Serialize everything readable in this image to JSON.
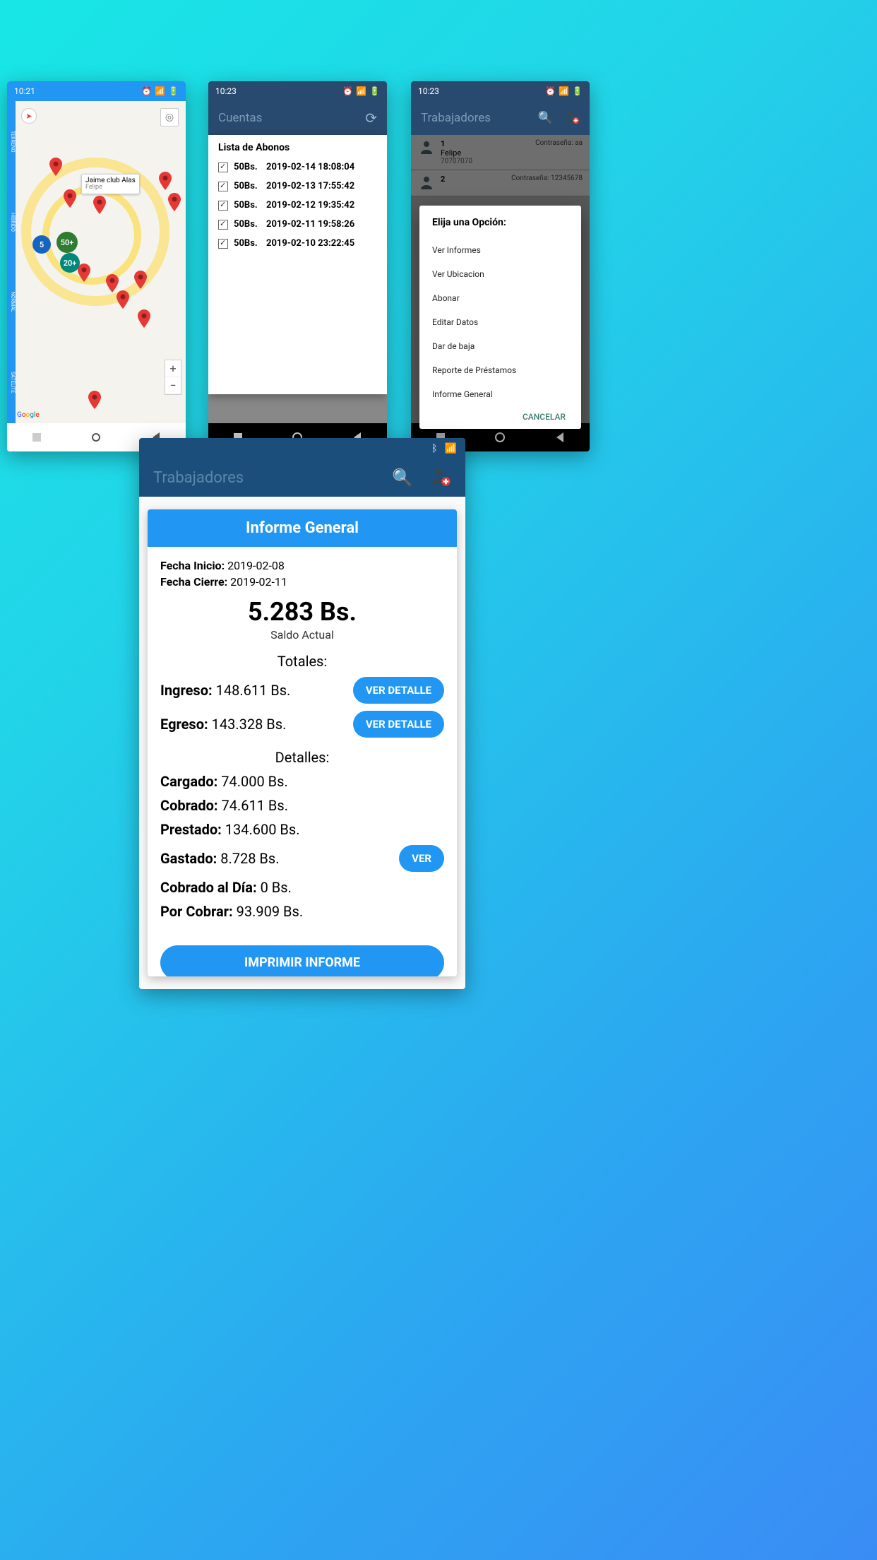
{
  "phone1": {
    "time": "10:21",
    "map": {
      "bubble_title": "Jaime club Alas",
      "bubble_sub": "Felipe",
      "clusters": {
        "green": "50+",
        "blue": "5",
        "teal": "20+"
      },
      "legend": [
        "TERRENO",
        "HÍBRIDO",
        "NORMAL",
        "SATÉLITE"
      ],
      "logo": "Google"
    }
  },
  "phone2": {
    "time": "10:23",
    "appbar": "Cuentas",
    "sheet_title": "Lista de Abonos",
    "abonos": [
      {
        "amount": "50Bs.",
        "ts": "2019-02-14 18:08:04"
      },
      {
        "amount": "50Bs.",
        "ts": "2019-02-13 17:55:42"
      },
      {
        "amount": "50Bs.",
        "ts": "2019-02-12 19:35:42"
      },
      {
        "amount": "50Bs.",
        "ts": "2019-02-11 19:58:26"
      },
      {
        "amount": "50Bs.",
        "ts": "2019-02-10 23:22:45"
      }
    ]
  },
  "phone3": {
    "time": "10:23",
    "appbar": "Trabajadores",
    "workers": [
      {
        "n": "1",
        "name": "Felipe",
        "phone": "70707070",
        "pass_label": "Contraseña:",
        "pass": "aa"
      },
      {
        "n": "2",
        "name": "",
        "phone": "",
        "pass_label": "Contraseña:",
        "pass": "12345678"
      }
    ],
    "dialog": {
      "title": "Elija una Opción:",
      "options": [
        "Ver Informes",
        "Ver Ubicacion",
        "Abonar",
        "Editar Datos",
        "Dar de baja",
        "Reporte de Préstamos",
        "Informe General"
      ],
      "cancel": "CANCELAR"
    }
  },
  "phone4": {
    "appbar": "Trabajadores",
    "card_title": "Informe General",
    "fecha_inicio_label": "Fecha Inicio:",
    "fecha_inicio": "2019-02-08",
    "fecha_cierre_label": "Fecha Cierre:",
    "fecha_cierre": "2019-02-11",
    "balance": "5.283 Bs.",
    "balance_sub": "Saldo Actual",
    "totales_label": "Totales:",
    "ingreso_label": "Ingreso:",
    "ingreso": "148.611 Bs.",
    "egreso_label": "Egreso:",
    "egreso": "143.328 Bs.",
    "ver_detalle": "VER DETALLE",
    "detalles_label": "Detalles:",
    "cargado_label": "Cargado:",
    "cargado": "74.000 Bs.",
    "cobrado_label": "Cobrado:",
    "cobrado": "74.611 Bs.",
    "prestado_label": "Prestado:",
    "prestado": "134.600 Bs.",
    "gastado_label": "Gastado:",
    "gastado": "8.728 Bs.",
    "ver": "VER",
    "cobrado_dia_label": "Cobrado al Día:",
    "cobrado_dia": "0 Bs.",
    "por_cobrar_label": "Por Cobrar:",
    "por_cobrar": "93.909 Bs.",
    "print": "IMPRIMIR INFORME"
  }
}
